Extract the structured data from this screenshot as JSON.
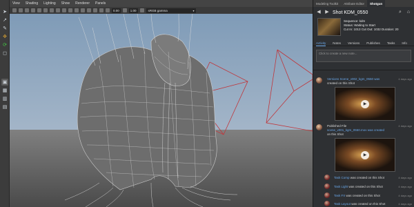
{
  "menubar": {
    "items": [
      "View",
      "Shading",
      "Lighting",
      "Show",
      "Renderer",
      "Panels"
    ]
  },
  "toolbar": {
    "field_a": "0.00",
    "field_b": "1.00",
    "colorspace": "sRGB gamma"
  },
  "panel": {
    "tabs": [
      "Modeling Toolkit",
      "Attribute Editor",
      "Shotgun"
    ],
    "shot_title": "Shot KDM_0550",
    "sequence": "Sequence: kdm",
    "status": "Status: Waiting to Start",
    "cuts": "Cut In: 1013  Cut Out: 1032  Duration: 20",
    "subtabs": [
      "Activity",
      "Notes",
      "Versions",
      "Publishes",
      "Tasks",
      "Info"
    ],
    "note_placeholder": "Click to create a new note...",
    "feed": [
      {
        "lines": [
          "Versions Scene_v002_kgm_0550 was",
          "created on this Shot"
        ],
        "time": "4 days ago"
      },
      {
        "lines": [
          "Published File",
          "scene_v001_kgm_0550.mov was created",
          "on this Shot"
        ],
        "time": "4 days ago"
      }
    ],
    "tasks": [
      {
        "name": "Task Comp",
        "rest": " was created on this Shot",
        "time": "4 days ago"
      },
      {
        "name": "Task Light",
        "rest": " was created on this Shot",
        "time": "4 days ago"
      },
      {
        "name": "Task FX",
        "rest": " was created on this Shot",
        "time": "4 days ago"
      },
      {
        "name": "Task Layout",
        "rest": " was created on this Shot",
        "time": "4 days ago"
      }
    ]
  },
  "colors": {
    "accent": "#6aa7e8",
    "camera_frustum": "#c0353a",
    "viewport_sky": "#8ea7bf",
    "viewport_ground": "#707070"
  },
  "icons": [
    "select-arrow-icon",
    "lasso-icon",
    "paint-icon",
    "move-icon",
    "rotate-icon",
    "scale-icon",
    "back-icon",
    "forward-icon",
    "search-icon",
    "home-icon",
    "play-icon"
  ]
}
